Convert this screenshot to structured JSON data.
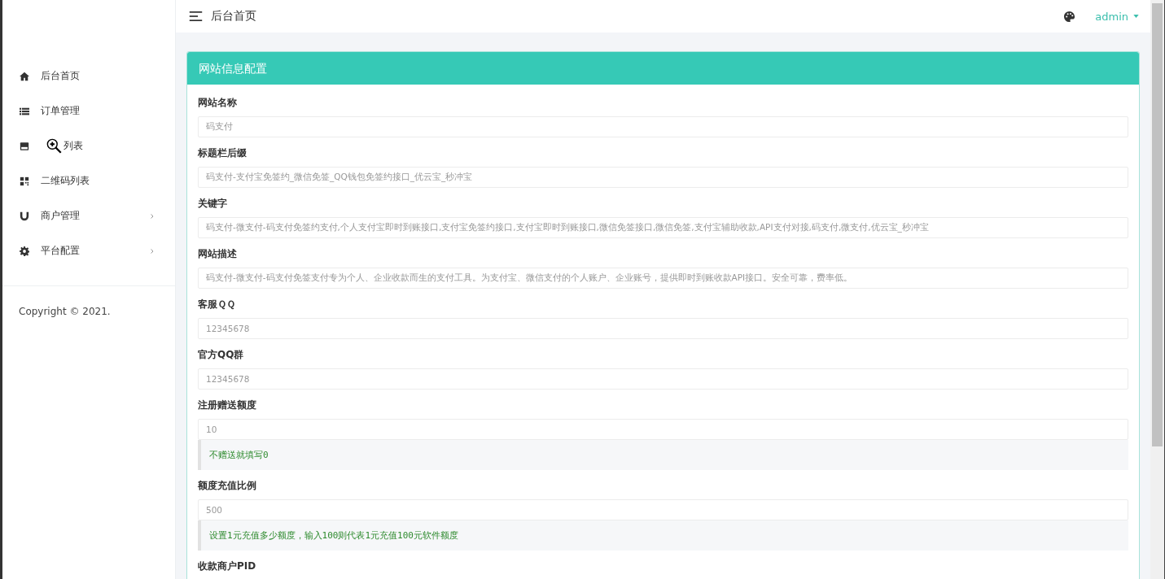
{
  "header": {
    "title": "后台首页",
    "user": "admin"
  },
  "sidebar": {
    "items": [
      {
        "label": "后台首页",
        "has_submenu": false,
        "cursor_over": false
      },
      {
        "label": "订单管理",
        "has_submenu": false,
        "cursor_over": false
      },
      {
        "label": "列表",
        "has_submenu": false,
        "cursor_over": true
      },
      {
        "label": "二维码列表",
        "has_submenu": false,
        "cursor_over": false
      },
      {
        "label": "商户管理",
        "has_submenu": true,
        "cursor_over": false
      },
      {
        "label": "平台配置",
        "has_submenu": true,
        "cursor_over": false
      }
    ],
    "copyright": "Copyright © 2021."
  },
  "panel": {
    "title": "网站信息配置",
    "fields": [
      {
        "label": "网站名称",
        "value": "码支付"
      },
      {
        "label": "标题栏后缀",
        "value": "码支付-支付宝免签约_微信免签_QQ钱包免签约接口_优云宝_秒冲宝"
      },
      {
        "label": "关键字",
        "value": "码支付-微支付-码支付免签约支付,个人支付宝即时到账接口,支付宝免签约接口,支付宝即时到账接口,微信免签接口,微信免签,支付宝辅助收款,API支付对接,码支付,微支付,优云宝_秒冲宝"
      },
      {
        "label": "网站描述",
        "value": "码支付-微支付-码支付免签支付专为个人、企业收款而生的支付工具。为支付宝、微信支付的个人账户、企业账号，提供即时到账收款API接口。安全可靠，费率低。"
      },
      {
        "label": "客服ＱＱ",
        "value": "12345678"
      },
      {
        "label": "官方QQ群",
        "value": "12345678"
      },
      {
        "label": "注册赠送额度",
        "value": "10",
        "hint": "不赠送就填写0"
      },
      {
        "label": "额度充值比例",
        "value": "500",
        "hint": "设置1元充值多少额度，输入100则代表1元充值100元软件额度"
      },
      {
        "label": "收款商户PID"
      }
    ]
  }
}
